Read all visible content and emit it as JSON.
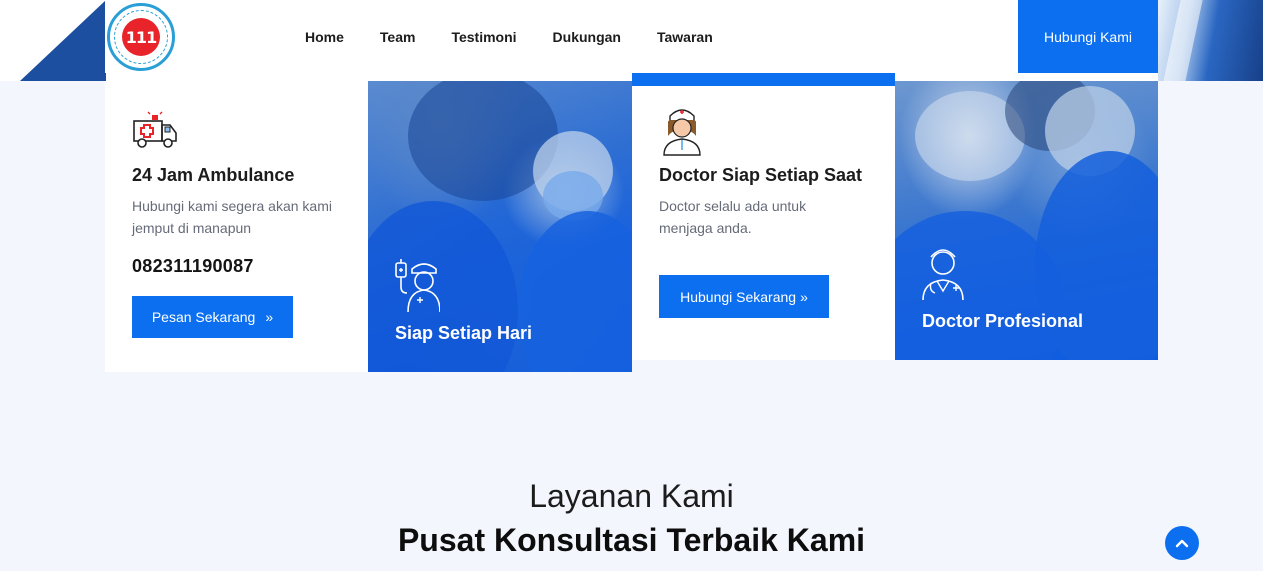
{
  "brand": {
    "logo_icon": "company-logo-seal",
    "logo_text": "111",
    "logo_ring_text": "PT. ONE ESA TUNGGAL INDONESIA"
  },
  "nav": {
    "items": [
      {
        "label": "Home"
      },
      {
        "label": "Team"
      },
      {
        "label": "Testimoni"
      },
      {
        "label": "Dukungan"
      },
      {
        "label": "Tawaran"
      }
    ],
    "cta_label": "Hubungi Kami"
  },
  "cards": [
    {
      "icon": "ambulance-icon",
      "title": "24 Jam Ambulance",
      "text": "Hubungi kami segera akan kami jemput di manapun",
      "phone": "082311190087",
      "button": "Pesan Sekarang"
    },
    {
      "icon": "nurse-iv-icon",
      "title": "Siap Setiap Hari"
    },
    {
      "icon": "nurse-icon",
      "title": "Doctor Siap Setiap Saat",
      "text": "Doctor selalu ada untuk menjaga anda.",
      "button": "Hubungi Sekarang"
    },
    {
      "icon": "doctor-icon",
      "title": "Doctor Profesional"
    }
  ],
  "section": {
    "subtitle": "Layanan Kami",
    "title": "Pusat Konsultasi Terbaik Kami"
  },
  "scroll_top_icon": "chevron-up-icon",
  "colors": {
    "accent": "#0c6ff0",
    "page_bg": "#f3f6fd",
    "text_dark": "#1c1c1c",
    "text_muted": "#666b78"
  }
}
